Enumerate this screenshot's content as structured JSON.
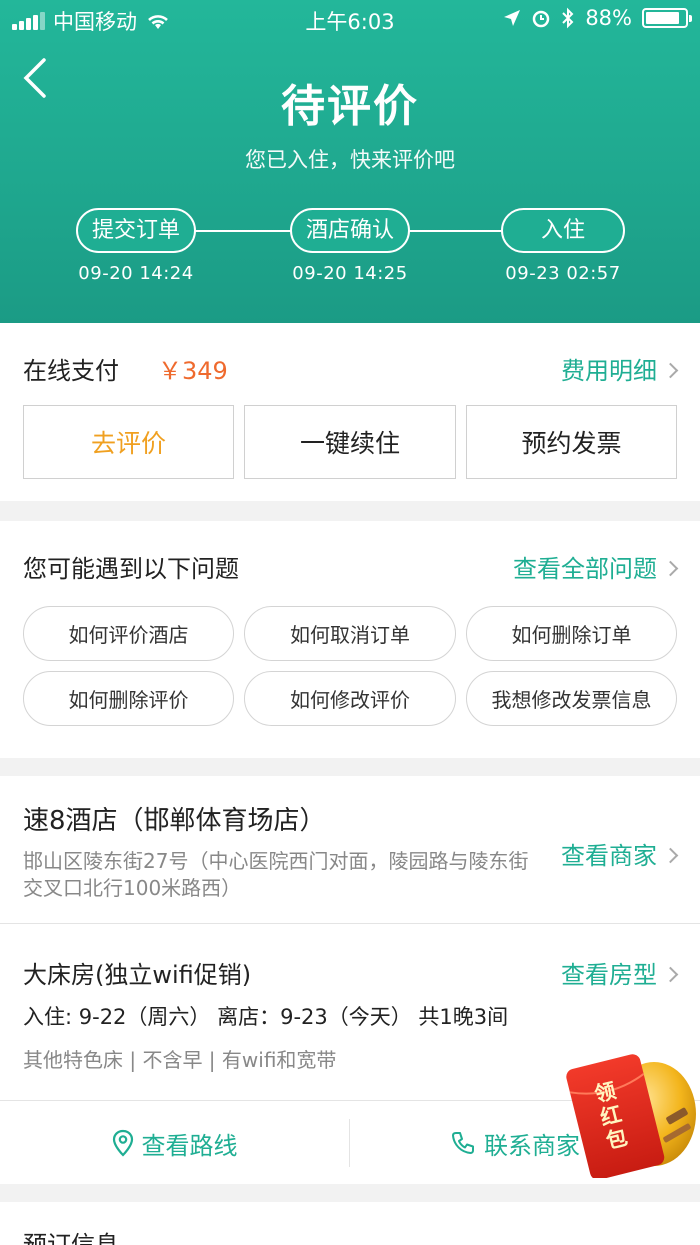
{
  "status_bar": {
    "carrier": "中国移动",
    "time": "上午6:03",
    "battery": "88%",
    "battery_level": 0.88
  },
  "header": {
    "title": "待评价",
    "subtitle": "您已入住，快来评价吧",
    "steps": [
      {
        "label": "提交订单",
        "time": "09-20 14:24"
      },
      {
        "label": "酒店确认",
        "time": "09-20 14:25"
      },
      {
        "label": "入住",
        "time": "09-23 02:57"
      }
    ]
  },
  "payment": {
    "label": "在线支付",
    "amount": "￥349",
    "detail_link": "费用明细",
    "actions": [
      "去评价",
      "一键续住",
      "预约发票"
    ]
  },
  "faq": {
    "title": "您可能遇到以下问题",
    "all_link": "查看全部问题",
    "questions": [
      "如何评价酒店",
      "如何取消订单",
      "如何删除订单",
      "如何删除评价",
      "如何修改评价",
      "我想修改发票信息"
    ]
  },
  "hotel": {
    "name": "速8酒店（邯郸体育场店）",
    "address": "邯山区陵东街27号（中心医院西门对面，陵园路与陵东街交叉口北行100米路西）",
    "link": "查看商家",
    "room_name": "大床房(独立wifi促销)",
    "room_link": "查看房型",
    "dates": "入住: 9-22（周六） 离店：9-23（今天） 共1晚3间",
    "features": "其他特色床 | 不含早 | 有wifi和宽带",
    "route_label": "查看路线",
    "contact_label": "联系商家"
  },
  "booking": {
    "title": "预订信息"
  },
  "red_packet": {
    "label": "领红包"
  },
  "colors": {
    "accent": "#1fae93",
    "price": "#ef6a2e",
    "action_highlight": "#f0a020"
  }
}
